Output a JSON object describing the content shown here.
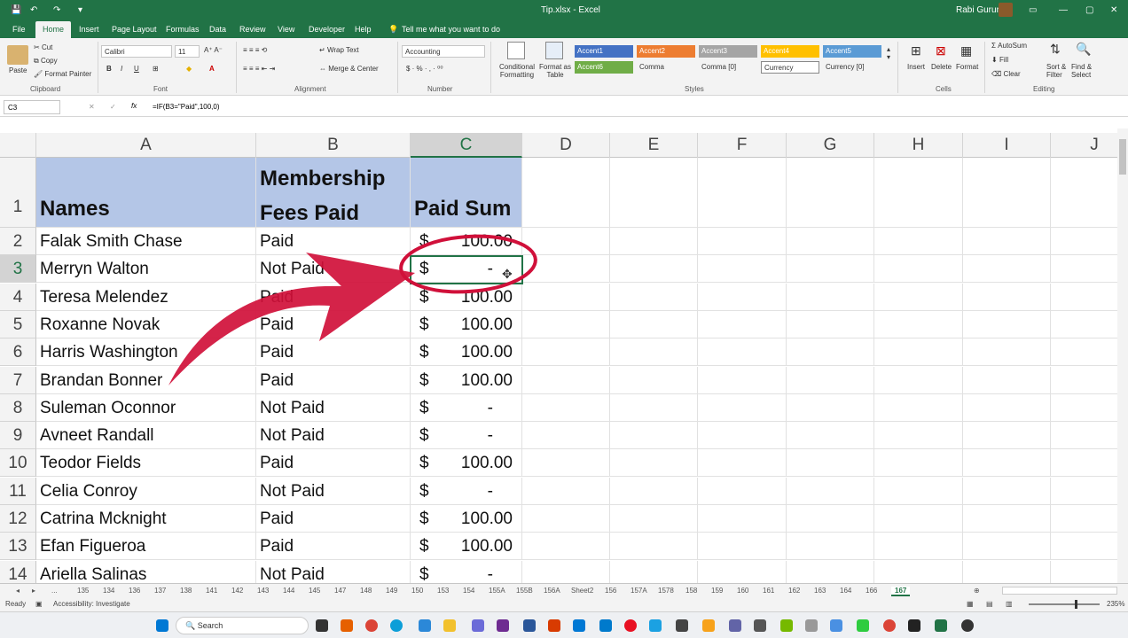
{
  "titlebar": {
    "filename": "Tip.xlsx",
    "app": "Excel",
    "user": "Rabi Gurung"
  },
  "tabs": [
    "File",
    "Home",
    "Insert",
    "Page Layout",
    "Formulas",
    "Data",
    "Review",
    "View",
    "Developer",
    "Help"
  ],
  "tell_me": "Tell me what you want to do",
  "ribbon": {
    "clipboard": {
      "paste": "Paste",
      "cut": "Cut",
      "copy": "Copy",
      "format_painter": "Format Painter",
      "label": "Clipboard"
    },
    "font": {
      "name": "Calibri",
      "size": "11",
      "label": "Font"
    },
    "alignment": {
      "wrap": "Wrap Text",
      "merge": "Merge & Center",
      "label": "Alignment"
    },
    "number": {
      "format": "Accounting",
      "label": "Number"
    },
    "styles": {
      "cond": "Conditional Formatting",
      "table": "Format as Table",
      "label": "Styles",
      "items": [
        "Accent1",
        "Accent2",
        "Accent3",
        "Accent4",
        "Accent5",
        "Accent6",
        "Comma",
        "Comma [0]",
        "Currency",
        "Currency [0]"
      ]
    },
    "cells": {
      "insert": "Insert",
      "delete": "Delete",
      "format": "Format",
      "label": "Cells"
    },
    "editing": {
      "autosum": "AutoSum",
      "fill": "Fill",
      "clear": "Clear",
      "sort": "Sort & Filter",
      "find": "Find & Select",
      "label": "Editing"
    }
  },
  "formula_bar": {
    "namebox": "C3",
    "formula": "=IF(B3=\"Paid\",100,0)"
  },
  "columns": [
    "A",
    "B",
    "C",
    "D",
    "E",
    "F",
    "G",
    "H",
    "I",
    "J"
  ],
  "header": {
    "a": "Names",
    "b1": "Membership",
    "b2": "Fees Paid",
    "c": "Paid Sum"
  },
  "rows": [
    {
      "n": "2",
      "name": "Falak Smith Chase",
      "status": "Paid",
      "cur": "$",
      "amt": "100.00"
    },
    {
      "n": "3",
      "name": "Merryn Walton",
      "status": "Not Paid",
      "cur": "$",
      "amt": "-"
    },
    {
      "n": "4",
      "name": "Teresa Melendez",
      "status": "Paid",
      "cur": "$",
      "amt": "100.00"
    },
    {
      "n": "5",
      "name": "Roxanne Novak",
      "status": "Paid",
      "cur": "$",
      "amt": "100.00"
    },
    {
      "n": "6",
      "name": "Harris Washington",
      "status": "Paid",
      "cur": "$",
      "amt": "100.00"
    },
    {
      "n": "7",
      "name": "Brandan Bonner",
      "status": "Paid",
      "cur": "$",
      "amt": "100.00"
    },
    {
      "n": "8",
      "name": "Suleman Oconnor",
      "status": "Not Paid",
      "cur": "$",
      "amt": "-"
    },
    {
      "n": "9",
      "name": "Avneet Randall",
      "status": "Not Paid",
      "cur": "$",
      "amt": "-"
    },
    {
      "n": "10",
      "name": "Teodor Fields",
      "status": "Paid",
      "cur": "$",
      "amt": "100.00"
    },
    {
      "n": "11",
      "name": "Celia Conroy",
      "status": "Not Paid",
      "cur": "$",
      "amt": "-"
    },
    {
      "n": "12",
      "name": "Catrina Mcknight",
      "status": "Paid",
      "cur": "$",
      "amt": "100.00"
    },
    {
      "n": "13",
      "name": "Efan Figueroa",
      "status": "Paid",
      "cur": "$",
      "amt": "100.00"
    },
    {
      "n": "14",
      "name": "Ariella Salinas",
      "status": "Not Paid",
      "cur": "$",
      "amt": "-"
    }
  ],
  "sheet_tabs": [
    "...",
    "135",
    "134",
    "136",
    "137",
    "138",
    "141",
    "142",
    "143",
    "144",
    "145",
    "147",
    "148",
    "149",
    "150",
    "153",
    "154",
    "155A",
    "155B",
    "156A",
    "Sheet2",
    "156",
    "157A",
    "1578",
    "158",
    "159",
    "160",
    "161",
    "162",
    "163",
    "164",
    "166",
    "167"
  ],
  "active_sheet": "167",
  "status": {
    "ready": "Ready",
    "accessibility": "Accessibility: Investigate",
    "zoom": "235%"
  },
  "taskbar": {
    "search": "Search"
  },
  "colors": {
    "excel_green": "#217346",
    "header_fill": "#b4c6e7",
    "annotation": "#d0103a"
  }
}
